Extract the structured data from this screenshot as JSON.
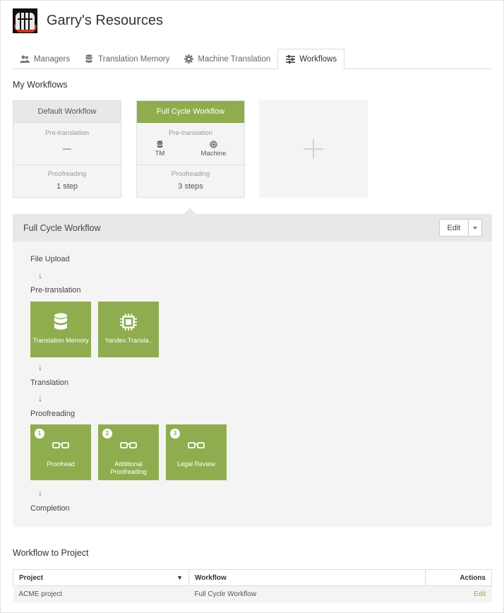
{
  "header": {
    "title": "Garry's Resources"
  },
  "tabs": [
    {
      "label": "Managers",
      "icon": "users-icon"
    },
    {
      "label": "Translation Memory",
      "icon": "database-icon"
    },
    {
      "label": "Machine Translation",
      "icon": "gear-icon"
    },
    {
      "label": "Workflows",
      "icon": "workflows-icon",
      "active": true
    }
  ],
  "my_workflows": {
    "title": "My Workflows",
    "cards": [
      {
        "name": "Default Workflow",
        "pretranslation_label": "Pre-translation",
        "pretranslation_value": "—",
        "proofreading_label": "Proofreading",
        "steps": "1 step"
      },
      {
        "name": "Full Cycle Workflow",
        "pretranslation_label": "Pre-translation",
        "items": [
          "TM",
          "Machine"
        ],
        "proofreading_label": "Proofreading",
        "steps": "3 steps"
      }
    ]
  },
  "detail": {
    "title": "Full Cycle Workflow",
    "edit_label": "Edit",
    "stages": [
      "File Upload",
      "Pre-translation",
      "Translation",
      "Proofreading",
      "Completion"
    ],
    "arrow": "↓",
    "pretranslation_tiles": [
      {
        "label": "Translation Memory",
        "icon": "database-icon"
      },
      {
        "label": "Yandex.Transla..",
        "icon": "chip-icon"
      }
    ],
    "proofreading_tiles": [
      {
        "number": "1",
        "label": "Proofread",
        "icon": "glasses-icon"
      },
      {
        "number": "2",
        "label": "Additional Proofreading",
        "icon": "glasses-icon"
      },
      {
        "number": "3",
        "label": "Legal Review",
        "icon": "glasses-icon"
      }
    ]
  },
  "workflow_to_project": {
    "title": "Workflow to Project",
    "columns": [
      "Project",
      "Workflow",
      "Actions"
    ],
    "rows": [
      {
        "project": "ACME project",
        "workflow": "Full Cycle Workflow",
        "action": "Edit"
      }
    ]
  },
  "colors": {
    "accent": "#8fad4f",
    "panel": "#f4f4f4",
    "panel_header": "#e8e8e8"
  }
}
